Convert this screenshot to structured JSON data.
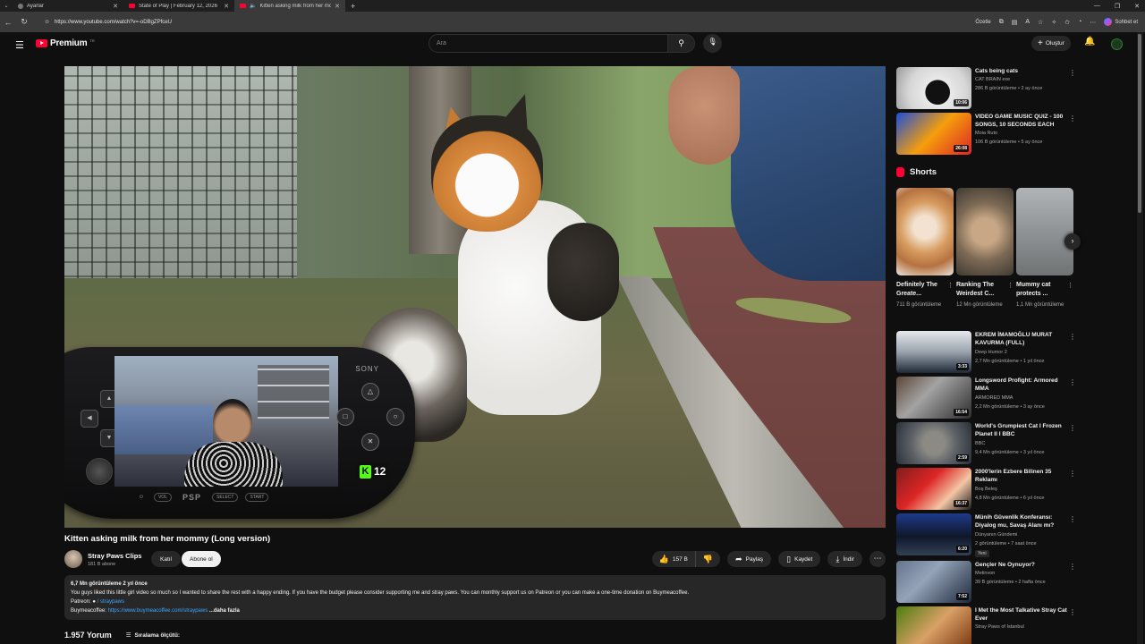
{
  "browser": {
    "tabs": [
      {
        "label": "Ayarlar",
        "icon": "gear-icon",
        "active": false
      },
      {
        "label": "State of Play | February 12, 2026",
        "icon": "youtube-icon",
        "active": false
      },
      {
        "label": "Kitten asking milk from her mommy",
        "icon": "speaker-icon",
        "active": true
      }
    ],
    "url": "https://www.youtube.com/watch?v=-oDBgZPfceU",
    "summarize_label": "Özetle",
    "chat_label": "Sohbet et"
  },
  "masthead": {
    "logo_text": "Premium",
    "logo_sup": "TR",
    "search_placeholder": "Ara",
    "create_label": "Oluştur"
  },
  "psp_overlay": {
    "brand": "SONY",
    "logo": "PSP",
    "vol_label": "VOL",
    "select_label": "SELECT",
    "start_label": "START",
    "kick_count": "12",
    "kick_letter": "K"
  },
  "video": {
    "title": "Kitten asking milk from her mommy (Long version)",
    "channel": "Stray Paws Clips",
    "subscribers": "181 B abone",
    "join_label": "Katıl",
    "subscribe_label": "Abone ol",
    "likes": "157 B",
    "share_label": "Paylaş",
    "save_label": "Kaydet",
    "download_label": "İndir",
    "meta": "6,7 Mn görüntüleme  2 yıl önce",
    "description": "You guys liked this little girl video so much so I wanted to share the rest with a happy ending. If you have the budget please consider supporting me and stray paws. You can monthly support us on Patreon or you can make a one-time donation on Buymeacoffee.",
    "patreon_label": "Patreon:",
    "patreon_link": "/ straypaws",
    "bmc_label": "Buymeacoffee:",
    "bmc_link": "https://www.buymeacoffee.com/straypaws",
    "more_label": "...daha fazla",
    "comments_count": "1.957 Yorum",
    "sort_label": "Sıralama ölçütü:"
  },
  "sidebar": {
    "top_items": [
      {
        "title": "Cats being cats",
        "channel": "CAT BRAIN exe",
        "views": "286 B görüntüleme • 2 ay önce",
        "duration": "10:06"
      },
      {
        "title": "VIDEO GAME MUSIC QUIZ - 100 SONGS, 10 SECONDS EACH",
        "channel": "Moia Ruto",
        "views": "106 B görüntüleme • 5 ay önce",
        "duration": "26:08"
      }
    ],
    "shorts_label": "Shorts",
    "shorts": [
      {
        "title": "Definitely The Greate...",
        "views": "711 B görüntüleme"
      },
      {
        "title": "Ranking The Weirdest C...",
        "views": "12 Mn görüntüleme"
      },
      {
        "title": "Mummy cat protects ...",
        "views": "1,1 Mn görüntüleme"
      }
    ],
    "items": [
      {
        "title": "EKREM İMAMOĞLU MURAT KAVURMA (FULL)",
        "channel": "Deep Humor 2",
        "views": "2,7 Mn görüntüleme • 1 yıl önce",
        "duration": "3:33",
        "verified": true
      },
      {
        "title": "Longsword Profight: Armored MMA",
        "channel": "ARMORED MMA",
        "views": "2,2 Mn görüntüleme • 3 ay önce",
        "duration": "16:54",
        "verified": false
      },
      {
        "title": "World's Grumpiest Cat I Frozen Planet II I BBC",
        "channel": "BBC",
        "views": "9,4 Mn görüntüleme • 3 yıl önce",
        "duration": "2:59",
        "verified": true
      },
      {
        "title": "2000'lerin Ezbere Bilinen 35 Reklamı",
        "channel": "Boş Beleş",
        "views": "4,8 Mn görüntüleme • 6 yıl önce",
        "duration": "16:37",
        "verified": false
      },
      {
        "title": "Münih Güvenlik Konferansı: Diyalog mu, Savaş Alanı mı?",
        "channel": "Dünyanın Gündemi",
        "views": "2 görüntüleme • 7 saat önce",
        "duration": "6:20",
        "verified": false,
        "badge": "Yeni"
      },
      {
        "title": "Gençler Ne Oynuyor?",
        "channel": "Metinvon",
        "views": "39 B görüntüleme • 2 hafta önce",
        "duration": "7:52",
        "verified": false
      },
      {
        "title": "I Met the Most Talkative Stray Cat Ever",
        "channel": "Stray Paws of Istanbul",
        "views": "",
        "duration": "",
        "verified": false
      }
    ]
  },
  "colors": {
    "background": "#0f0f0f",
    "brand_red": "#ff0033",
    "link_blue": "#3ea6ff",
    "kick_green": "#53fc18"
  }
}
